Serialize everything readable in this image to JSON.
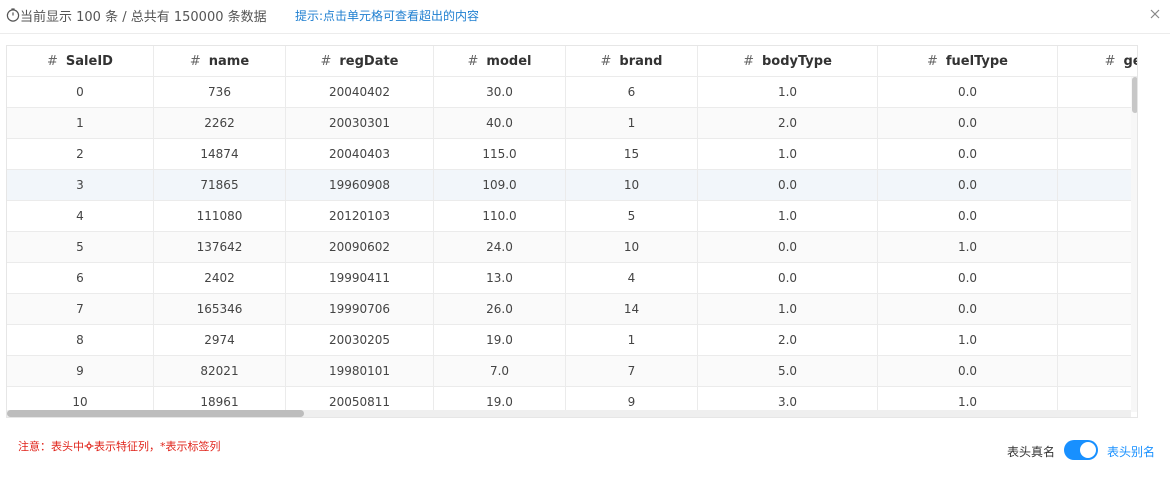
{
  "header": {
    "summary": "当前显示 100 条 / 总共有 150000 条数据",
    "hint": "提示:点击单元格可查看超出的内容",
    "icons": {
      "clock": "clock-icon",
      "close": "close-icon"
    }
  },
  "table": {
    "columns": [
      {
        "hash": "#",
        "name": "SaleID"
      },
      {
        "hash": "#",
        "name": "name"
      },
      {
        "hash": "#",
        "name": "regDate"
      },
      {
        "hash": "#",
        "name": "model"
      },
      {
        "hash": "#",
        "name": "brand"
      },
      {
        "hash": "#",
        "name": "bodyType"
      },
      {
        "hash": "#",
        "name": "fuelType"
      },
      {
        "hash": "#",
        "name": "gea"
      }
    ],
    "rows": [
      [
        "0",
        "736",
        "20040402",
        "30.0",
        "6",
        "1.0",
        "0.0",
        ""
      ],
      [
        "1",
        "2262",
        "20030301",
        "40.0",
        "1",
        "2.0",
        "0.0",
        ""
      ],
      [
        "2",
        "14874",
        "20040403",
        "115.0",
        "15",
        "1.0",
        "0.0",
        ""
      ],
      [
        "3",
        "71865",
        "19960908",
        "109.0",
        "10",
        "0.0",
        "0.0",
        ""
      ],
      [
        "4",
        "111080",
        "20120103",
        "110.0",
        "5",
        "1.0",
        "0.0",
        ""
      ],
      [
        "5",
        "137642",
        "20090602",
        "24.0",
        "10",
        "0.0",
        "1.0",
        ""
      ],
      [
        "6",
        "2402",
        "19990411",
        "13.0",
        "4",
        "0.0",
        "0.0",
        ""
      ],
      [
        "7",
        "165346",
        "19990706",
        "26.0",
        "14",
        "1.0",
        "0.0",
        ""
      ],
      [
        "8",
        "2974",
        "20030205",
        "19.0",
        "1",
        "2.0",
        "1.0",
        ""
      ],
      [
        "9",
        "82021",
        "19980101",
        "7.0",
        "7",
        "5.0",
        "0.0",
        ""
      ],
      [
        "10",
        "18961",
        "20050811",
        "19.0",
        "9",
        "3.0",
        "1.0",
        ""
      ]
    ]
  },
  "footer": {
    "note_prefix": "注意：表头中",
    "note_suffix": "表示特征列，*表示标签列",
    "toggle_left_label": "表头真名",
    "toggle_right_label": "表头别名",
    "toggle_on": true
  },
  "colors": {
    "accent": "#1890ff",
    "hint": "#1f7fd0",
    "warning": "#e0241b"
  }
}
